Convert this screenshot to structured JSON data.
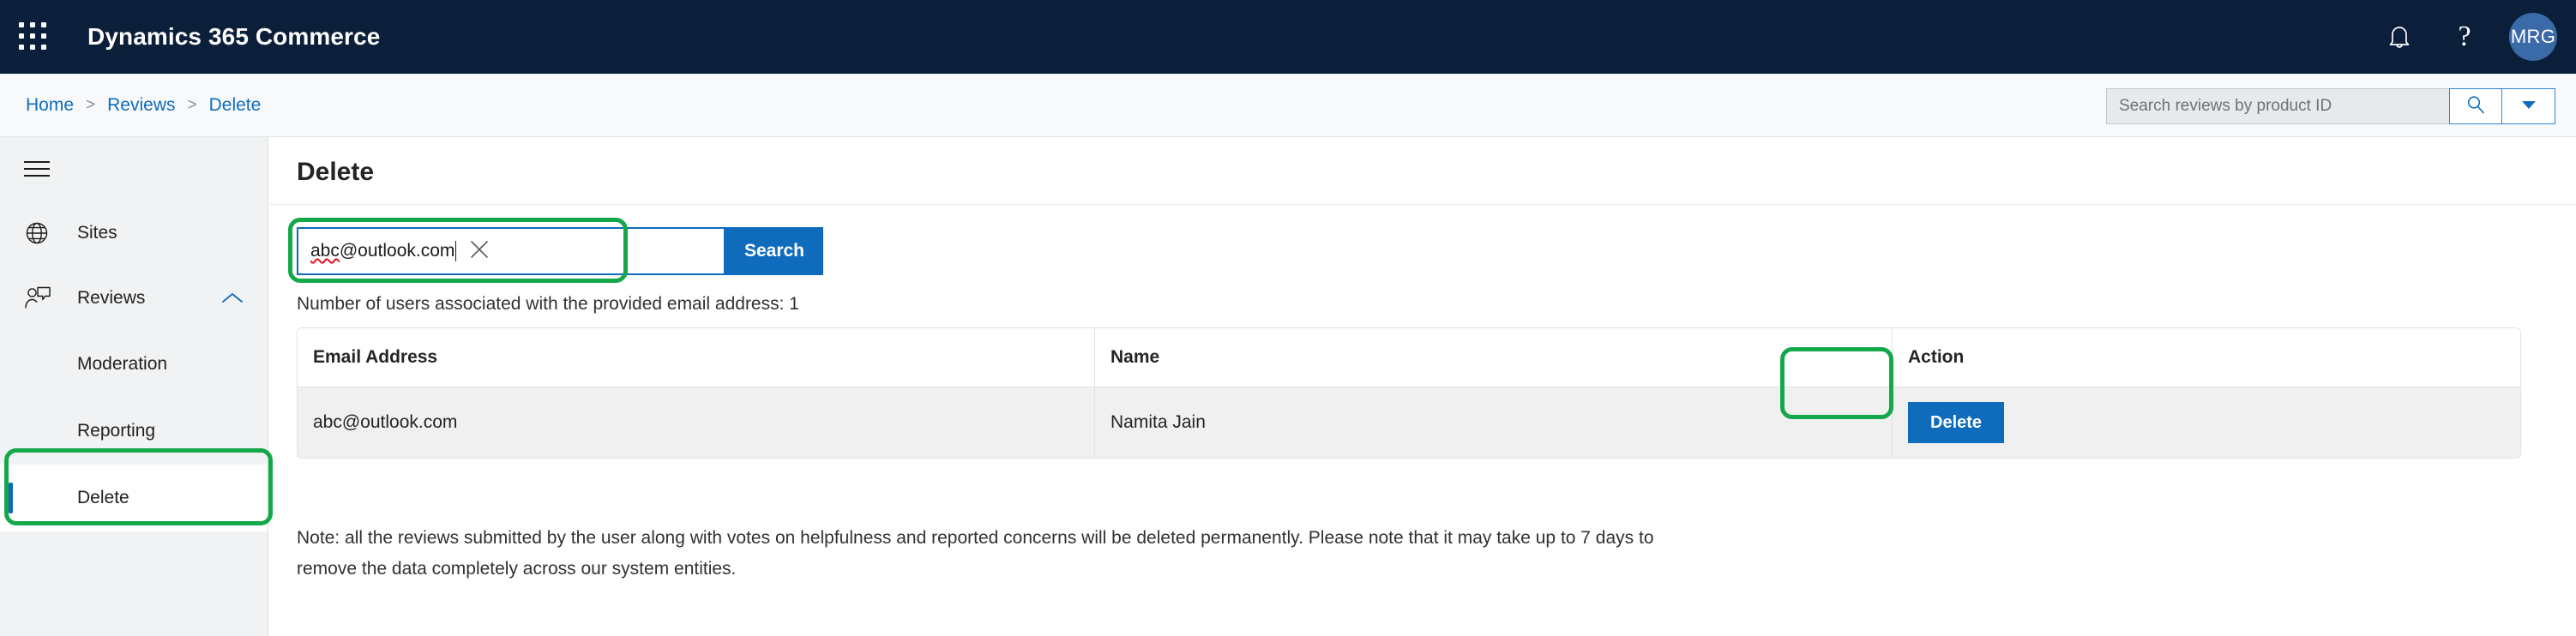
{
  "topbar": {
    "waffle_icon": "app-launcher-grid-icon",
    "app_title": "Dynamics 365 Commerce",
    "notifications_icon": "bell-icon",
    "help_icon": "question-mark-icon",
    "help_glyph": "?",
    "avatar_initials": "MRG",
    "background_color": "#0b1f3a",
    "avatar_color": "#3b6aa8"
  },
  "breadcrumb": {
    "items": [
      {
        "label": "Home"
      },
      {
        "label": "Reviews"
      },
      {
        "label": "Delete"
      }
    ],
    "separator": ">",
    "link_color": "#0f6cbd"
  },
  "global_search": {
    "value": "",
    "placeholder": "Search reviews by product ID",
    "search_icon": "magnifier-icon",
    "dropdown_icon": "chevron-down-icon"
  },
  "sidebar": {
    "hamburger_icon": "hamburger-menu-icon",
    "items": [
      {
        "label": "Sites",
        "icon": "globe-icon",
        "expandable": false,
        "selected": false
      },
      {
        "label": "Reviews",
        "icon": "reviews-person-comment-icon",
        "expandable": true,
        "expanded": true,
        "chevron_icon": "chevron-up-icon",
        "selected": false
      }
    ],
    "sub_items": [
      {
        "label": "Moderation",
        "selected": false
      },
      {
        "label": "Reporting",
        "selected": false
      },
      {
        "label": "Delete",
        "selected": true,
        "highlighted": true
      }
    ],
    "selected_accent_color": "#0f6cbd"
  },
  "main": {
    "page_title": "Delete",
    "search": {
      "value": "abc@outlook.com",
      "value_misspelled_part": "abc",
      "value_rest": "@outlook.com",
      "clear_icon": "close-x-icon",
      "button_label": "Search",
      "button_color": "#0f6cbd",
      "highlighted": true
    },
    "count_text": "Number of users associated with the provided email address: 1",
    "table": {
      "columns": [
        "Email Address",
        "Name",
        "Action"
      ],
      "rows": [
        {
          "email": "abc@outlook.com",
          "name": "Namita Jain",
          "action_label": "Delete"
        }
      ],
      "action_highlighted": true
    },
    "note": "Note: all the reviews submitted by the user along with votes on helpfulness and reported concerns will be deleted permanently. Please note that it may take up to 7 days to remove the data completely across our system entities."
  },
  "annotations": {
    "highlight_color": "#14a84b"
  }
}
